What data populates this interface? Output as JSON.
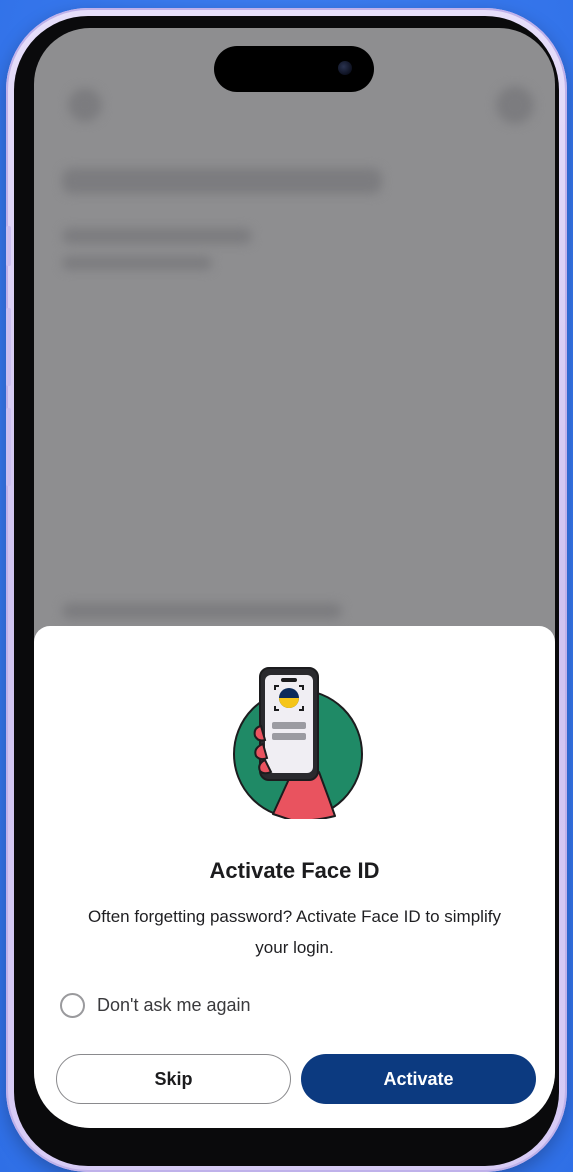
{
  "dialog": {
    "title": "Activate Face ID",
    "description": "Often forgetting password? Activate Face ID to simplify your login.",
    "checkbox_label": "Don't ask me again",
    "skip_label": "Skip",
    "activate_label": "Activate"
  },
  "icons": {
    "illustration": "face-id-phone-illustration",
    "checkbox": "radio-unchecked-icon"
  },
  "colors": {
    "background": "#3b7cf0",
    "primary_button": "#0c3a80",
    "illustration_circle": "#1f8a66",
    "illustration_hand": "#e9535f",
    "face_icon_yellow": "#f5c518",
    "face_icon_navy": "#0c2b5a"
  }
}
